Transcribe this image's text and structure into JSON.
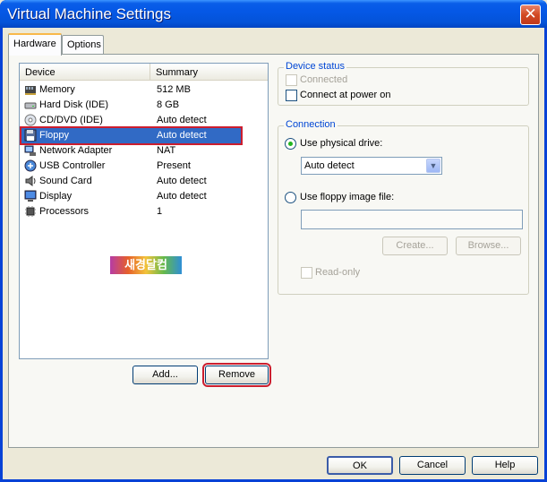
{
  "window": {
    "title": "Virtual Machine Settings"
  },
  "tabs": [
    {
      "label": "Hardware"
    },
    {
      "label": "Options"
    }
  ],
  "device_list": {
    "columns": {
      "device": "Device",
      "summary": "Summary"
    },
    "rows": [
      {
        "icon": "memory-icon",
        "name": "Memory",
        "summary": "512 MB"
      },
      {
        "icon": "hard-disk-icon",
        "name": "Hard Disk (IDE)",
        "summary": "8 GB"
      },
      {
        "icon": "cd-dvd-icon",
        "name": "CD/DVD (IDE)",
        "summary": "Auto detect"
      },
      {
        "icon": "floppy-icon",
        "name": "Floppy",
        "summary": "Auto detect"
      },
      {
        "icon": "network-adapter-icon",
        "name": "Network Adapter",
        "summary": "NAT"
      },
      {
        "icon": "usb-controller-icon",
        "name": "USB Controller",
        "summary": "Present"
      },
      {
        "icon": "sound-card-icon",
        "name": "Sound Card",
        "summary": "Auto detect"
      },
      {
        "icon": "display-icon",
        "name": "Display",
        "summary": "Auto detect"
      },
      {
        "icon": "processors-icon",
        "name": "Processors",
        "summary": "1"
      }
    ],
    "selected": "Floppy",
    "logo_text": "새경달컴"
  },
  "list_buttons": {
    "add": "Add...",
    "remove": "Remove"
  },
  "device_status": {
    "title": "Device status",
    "connected": "Connected",
    "connect_at_power_on": "Connect at power on"
  },
  "connection": {
    "title": "Connection",
    "use_physical_drive": "Use physical drive:",
    "physical_drive_value": "Auto detect",
    "use_floppy_image": "Use floppy image file:",
    "image_path": "",
    "create": "Create...",
    "browse": "Browse...",
    "read_only": "Read-only"
  },
  "footer": {
    "ok": "OK",
    "cancel": "Cancel",
    "help": "Help"
  },
  "colors": {
    "title_blue": "#0558e6",
    "selection": "#316ac5",
    "highlight_red": "#cc1e2e"
  }
}
